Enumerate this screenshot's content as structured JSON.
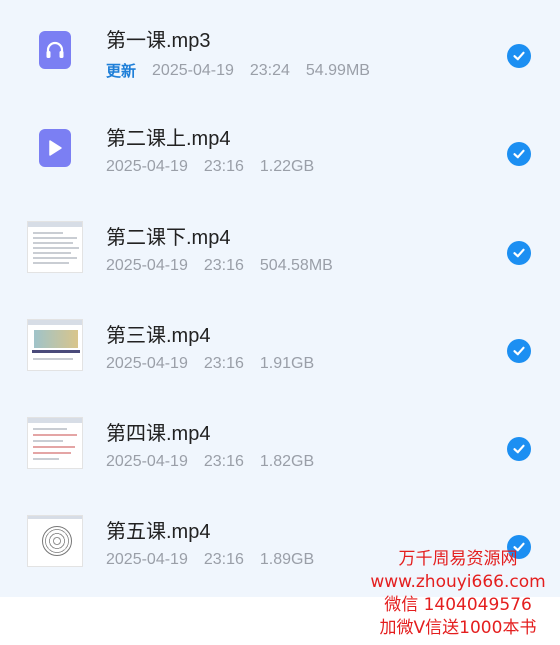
{
  "files": [
    {
      "name": "第一课.mp3",
      "badge": "更新",
      "date": "2025-04-19",
      "time": "23:24",
      "size": "54.99MB",
      "thumb": "audio-icon",
      "selected": true
    },
    {
      "name": "第二课上.mp4",
      "date": "2025-04-19",
      "time": "23:16",
      "size": "1.22GB",
      "thumb": "video-icon",
      "selected": true
    },
    {
      "name": "第二课下.mp4",
      "date": "2025-04-19",
      "time": "23:16",
      "size": "504.58MB",
      "thumb": "video-thumbnail",
      "selected": true
    },
    {
      "name": "第三课.mp4",
      "date": "2025-04-19",
      "time": "23:16",
      "size": "1.91GB",
      "thumb": "video-thumbnail",
      "selected": true
    },
    {
      "name": "第四课.mp4",
      "date": "2025-04-19",
      "time": "23:16",
      "size": "1.82GB",
      "thumb": "video-thumbnail",
      "selected": true
    },
    {
      "name": "第五课.mp4",
      "date": "2025-04-19",
      "time": "23:16",
      "size": "1.89GB",
      "thumb": "video-thumbnail",
      "selected": true
    }
  ],
  "watermark": {
    "line1": "万千周易资源网",
    "line2": "www.zhouyi666.com",
    "line3": "微信 1404049576",
    "line4": "加微V信送1000本书"
  },
  "colors": {
    "accent": "#1c8ff2",
    "list_bg": "#f0f6fd",
    "icon": "#7b7ff3",
    "watermark": "#e41e1e"
  }
}
